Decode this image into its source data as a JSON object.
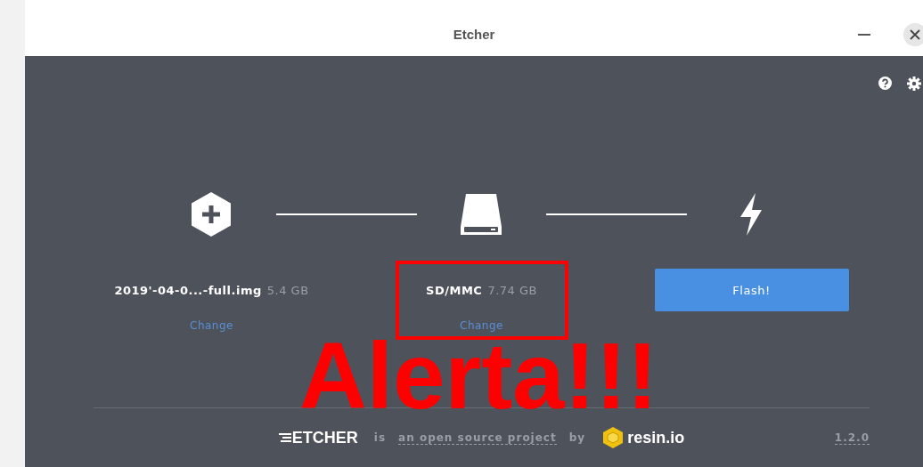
{
  "window": {
    "title": "Etcher"
  },
  "steps": [
    {
      "kind": "image",
      "name": "2019'-04-0...-full.img",
      "size": "5.4 GB",
      "action": "Change",
      "highlighted": false
    },
    {
      "kind": "drive",
      "name": "SD/MMC",
      "size": "7.74 GB",
      "action": "Change",
      "highlighted": true
    },
    {
      "kind": "flash",
      "button": "Flash!"
    }
  ],
  "overlay": {
    "text": "Alerta!!!"
  },
  "footer": {
    "logo": "ETCHER",
    "is": "is",
    "link": "an open source project",
    "by": "by",
    "brand": "resin.io",
    "version": "1.2.0"
  }
}
